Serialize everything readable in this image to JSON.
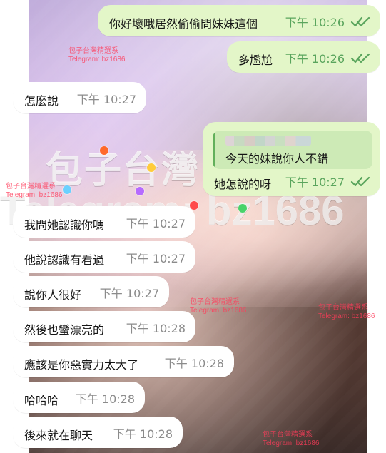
{
  "background": {
    "watermark": {
      "big_title": "包子台灣",
      "big_telegram": "Telegram: bz1686",
      "small_lines": [
        "包子台灣精選系",
        "Telegram: bz1686"
      ]
    },
    "colors": {
      "incoming_bubble": "#ffffff",
      "outgoing_bubble": "#e3f6c8",
      "incoming_meta": "#8b8b8b",
      "outgoing_meta": "#5aa55d",
      "quote_bar": "#62b05b"
    }
  },
  "messages": [
    {
      "text": "你好壞哦居然偷偷問妹妹這個",
      "time": "下午 10:26",
      "status_icon": "double-check-icon"
    },
    {
      "text": "多尷尬",
      "time": "下午 10:26",
      "status_icon": "double-check-icon"
    },
    {
      "text": "怎麼說",
      "time": "下午 10:27"
    },
    {
      "quote_text": "今天的妹說你人不錯",
      "text": "她怎說的呀",
      "time": "下午 10:27",
      "status_icon": "double-check-icon"
    },
    {
      "text": "我問她認識你嗎",
      "time": "下午 10:27"
    },
    {
      "text": "他說認識有看過",
      "time": "下午 10:27"
    },
    {
      "text": "說你人很好",
      "time": "下午 10:27"
    },
    {
      "text": "然後也蠻漂亮的",
      "time": "下午 10:28"
    },
    {
      "text": "應該是你惡實力太大了",
      "time": "下午 10:28"
    },
    {
      "text": "哈哈哈",
      "time": "下午 10:28"
    },
    {
      "text": "後來就在聊天",
      "time": "下午 10:28"
    }
  ]
}
